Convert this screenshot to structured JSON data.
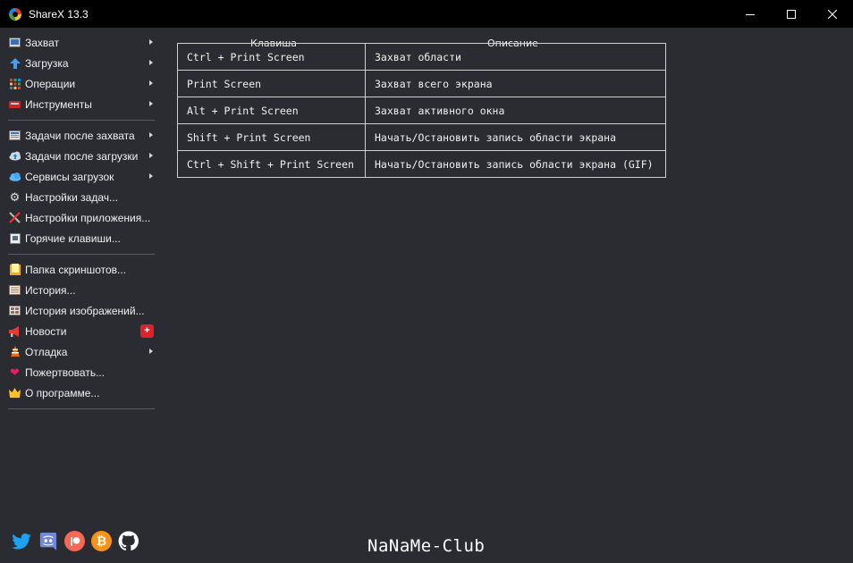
{
  "window": {
    "title": "ShareX 13.3",
    "controls": {
      "minimize": "—",
      "maximize": "☐",
      "close": "✕"
    }
  },
  "menu": {
    "group1": [
      {
        "label": "Захват",
        "icon": "capture-icon",
        "submenu": true
      },
      {
        "label": "Загрузка",
        "icon": "upload-icon",
        "submenu": true
      },
      {
        "label": "Операции",
        "icon": "workflows-icon",
        "submenu": true
      },
      {
        "label": "Инструменты",
        "icon": "tools-icon",
        "submenu": true
      }
    ],
    "group2": [
      {
        "label": "Задачи после захвата",
        "icon": "after-capture-icon",
        "submenu": true
      },
      {
        "label": "Задачи после загрузки",
        "icon": "after-upload-icon",
        "submenu": true
      },
      {
        "label": "Сервисы загрузок",
        "icon": "destinations-icon",
        "submenu": true
      },
      {
        "label": "Настройки задач...",
        "icon": "gear-icon",
        "submenu": false
      },
      {
        "label": "Настройки приложения...",
        "icon": "wrench-icon",
        "submenu": false
      },
      {
        "label": "Горячие клавиши...",
        "icon": "keyboard-icon",
        "submenu": false
      }
    ],
    "group3": [
      {
        "label": "Папка скриншотов...",
        "icon": "folder-icon",
        "submenu": false
      },
      {
        "label": "История...",
        "icon": "history-icon",
        "submenu": false
      },
      {
        "label": "История изображений...",
        "icon": "image-history-icon",
        "submenu": false
      },
      {
        "label": "Новости",
        "icon": "megaphone-icon",
        "submenu": false,
        "badge": "+"
      },
      {
        "label": "Отладка",
        "icon": "debug-icon",
        "submenu": true
      },
      {
        "label": "Пожертвовать...",
        "icon": "heart-icon",
        "submenu": false
      },
      {
        "label": "О программе...",
        "icon": "crown-icon",
        "submenu": false
      }
    ]
  },
  "hotkeys": {
    "headers": {
      "key": "Клавиша",
      "description": "Описание"
    },
    "rows": [
      {
        "key": "Ctrl + Print Screen",
        "description": "Захват области"
      },
      {
        "key": "Print Screen",
        "description": "Захват всего экрана"
      },
      {
        "key": "Alt + Print Screen",
        "description": "Захват активного окна"
      },
      {
        "key": "Shift + Print Screen",
        "description": "Начать/Остановить запись области экрана"
      },
      {
        "key": "Ctrl + Shift + Print Screen",
        "description": "Начать/Остановить запись области экрана (GIF)"
      }
    ]
  },
  "social": [
    "twitter-icon",
    "discord-icon",
    "patreon-icon",
    "bitcoin-icon",
    "github-icon"
  ],
  "watermark": "NaNaMe-Club",
  "colors": {
    "background": "#2a2c31",
    "titlebar": "#000000",
    "badge": "#e0202a",
    "twitter": "#1da1f2",
    "discord": "#5865f2",
    "patreon": "#f96854",
    "bitcoin": "#f7931a"
  }
}
